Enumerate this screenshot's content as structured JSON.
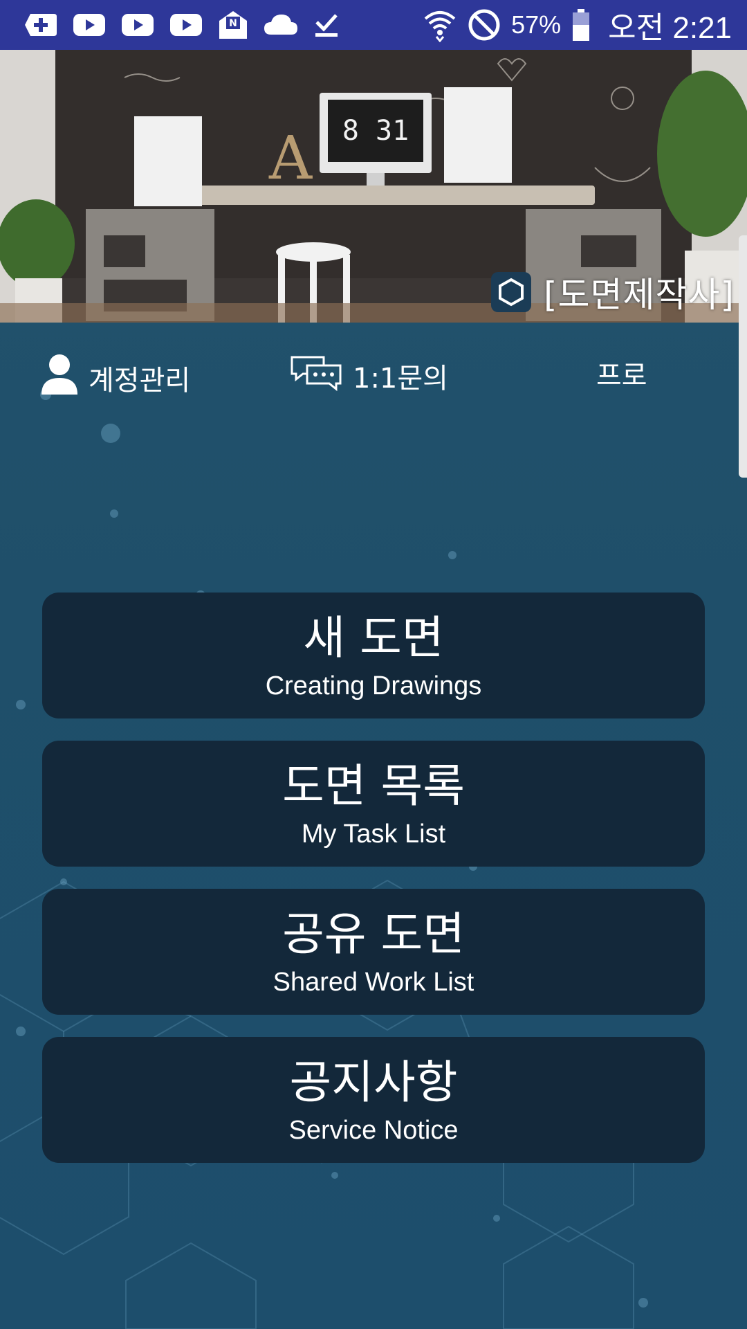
{
  "status_bar": {
    "battery": "57%",
    "time": "오전 2:21",
    "icons": [
      "plus-icon",
      "youtube-icon",
      "youtube-icon",
      "youtube-icon",
      "naver-mail-icon",
      "cloud-icon",
      "download-done-icon",
      "wifi-icon",
      "do-not-disturb-icon",
      "battery-icon"
    ]
  },
  "banner": {
    "clock": "8 31",
    "title": "[도면제작사]"
  },
  "top_nav": {
    "account": "계정관리",
    "inquiry": "1:1문의",
    "pro": "프로"
  },
  "menu": [
    {
      "title": "새 도면",
      "subtitle": "Creating Drawings"
    },
    {
      "title": "도면 목록",
      "subtitle": "My Task List"
    },
    {
      "title": "공유 도면",
      "subtitle": "Shared Work List"
    },
    {
      "title": "공지사항",
      "subtitle": "Service Notice"
    }
  ],
  "colors": {
    "status_bar": "#2e3799",
    "background": "#1f4f6a",
    "button": "#13283a",
    "text": "#ffffff"
  }
}
